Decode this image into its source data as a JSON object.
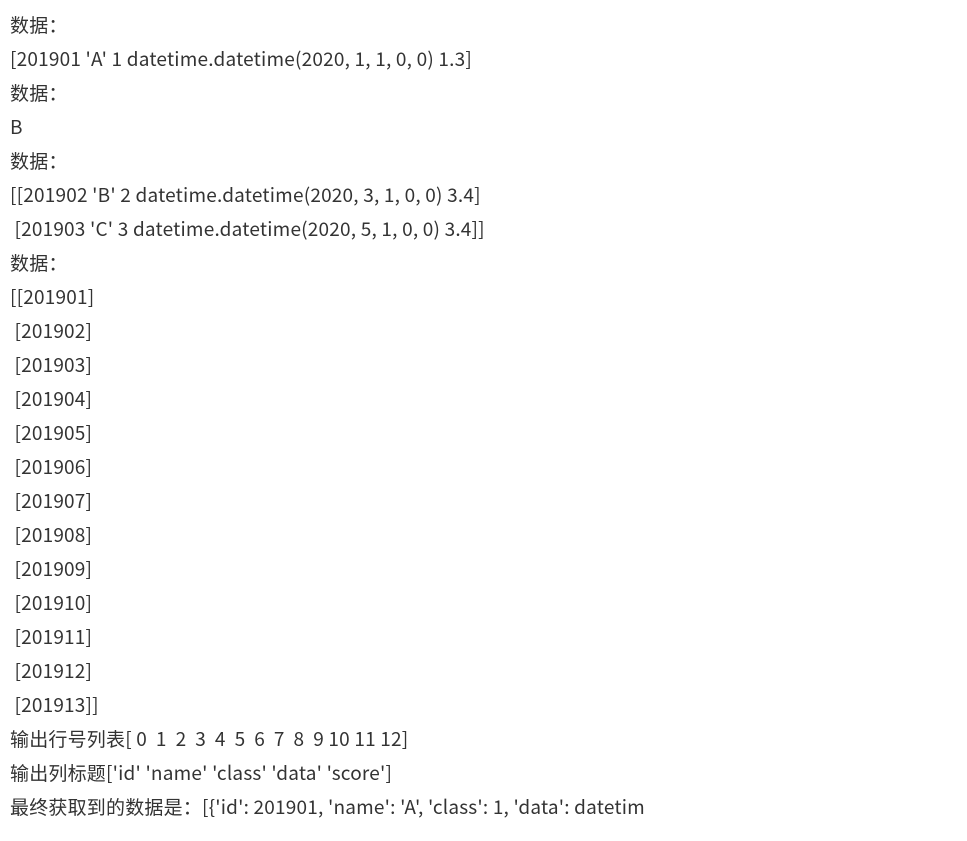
{
  "lines": [
    "数据：",
    "[201901 'A' 1 datetime.datetime(2020, 1, 1, 0, 0) 1.3]",
    "数据：",
    "B",
    "数据：",
    "[[201902 'B' 2 datetime.datetime(2020, 3, 1, 0, 0) 3.4]",
    " [201903 'C' 3 datetime.datetime(2020, 5, 1, 0, 0) 3.4]]",
    "数据：",
    "[[201901]",
    " [201902]",
    " [201903]",
    " [201904]",
    " [201905]",
    " [201906]",
    " [201907]",
    " [201908]",
    " [201909]",
    " [201910]",
    " [201911]",
    " [201912]",
    " [201913]]",
    "输出行号列表[ 0  1  2  3  4  5  6  7  8  9 10 11 12]",
    "输出列标题['id' 'name' 'class' 'data' 'score']",
    "最终获取到的数据是：[{'id': 201901, 'name': 'A', 'class': 1, 'data': datetim"
  ]
}
